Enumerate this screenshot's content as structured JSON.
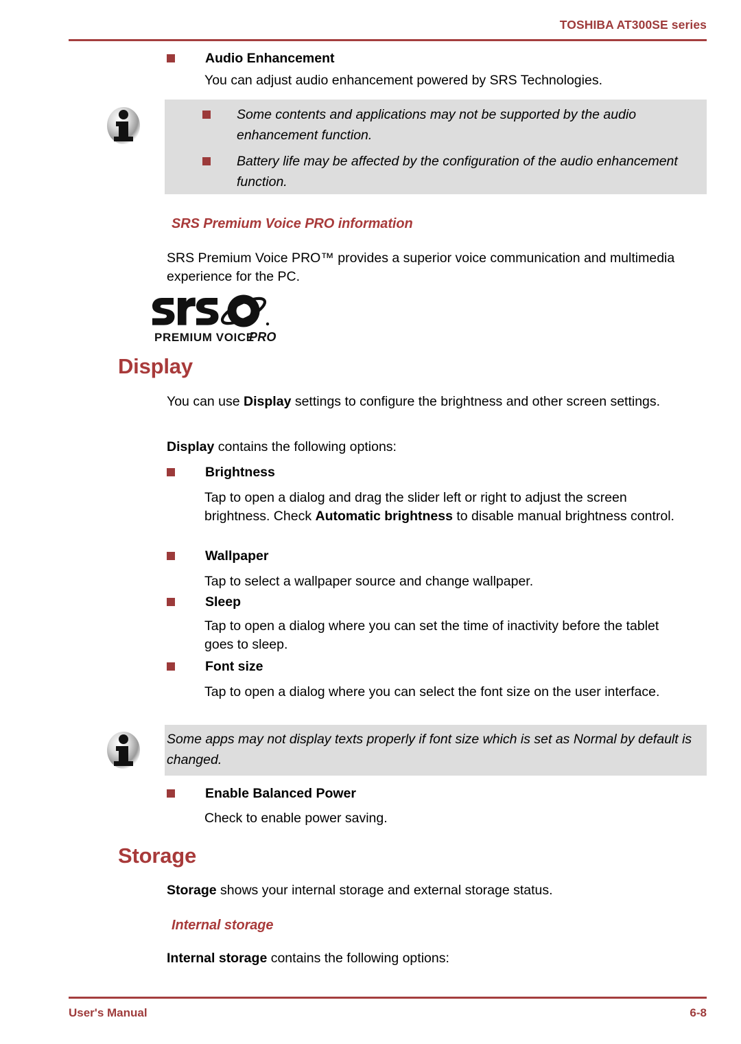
{
  "header": {
    "title": "TOSHIBA AT300SE series"
  },
  "footer": {
    "manual_label": "User's Manual",
    "page_number": "6-8"
  },
  "colors": {
    "accent_red": "#a83a3a",
    "header_red": "#9e3b3b",
    "bullet_red": "#9c3a3a",
    "note_background": "#dddddd",
    "rule_red": "#a43e3e"
  },
  "content": {
    "audio_enhancement": {
      "bullet_label": "Audio Enhancement",
      "description": "You can adjust audio enhancement powered by SRS Technologies."
    },
    "note_audio": {
      "icon": "info-icon",
      "items": [
        "Some contents and applications may not be supported by the audio enhancement function.",
        "Battery life may be affected by the configuration of the audio enhancement function."
      ]
    },
    "srs_section": {
      "heading": "SRS Premium Voice PRO information",
      "paragraph": "SRS Premium Voice PRO™ provides a superior voice communication and multimedia experience for the PC.",
      "logo": {
        "wordmark": "srs",
        "tagline": "PREMIUM VOICE PRO"
      }
    },
    "display_section": {
      "heading": "Display",
      "intro_pre": "You can use ",
      "intro_bold": "Display",
      "intro_post": " settings to configure the brightness and other screen settings.",
      "contains_bold": "Display",
      "contains_post": " contains the following options:",
      "options": [
        {
          "label": "Brightness",
          "desc_pre": "Tap to open a dialog and drag the slider left or right to adjust the screen brightness. Check ",
          "desc_bold": "Automatic brightness",
          "desc_post": " to disable manual brightness control."
        },
        {
          "label": "Wallpaper",
          "desc_pre": "Tap to select a wallpaper source and change wallpaper.",
          "desc_bold": "",
          "desc_post": ""
        },
        {
          "label": "Sleep",
          "desc_pre": "Tap to open a dialog where you can set the time of inactivity before the tablet goes to sleep.",
          "desc_bold": "",
          "desc_post": ""
        },
        {
          "label": "Font size",
          "desc_pre": "Tap to open a dialog where you can select the font size on the user interface.",
          "desc_bold": "",
          "desc_post": ""
        }
      ]
    },
    "note_fontsize": {
      "icon": "info-icon",
      "text": "Some apps may not display texts properly if font size which is set as Normal by default is changed."
    },
    "balanced_power": {
      "bullet_label": "Enable Balanced Power",
      "description": "Check to enable power saving."
    },
    "storage_section": {
      "heading": "Storage",
      "intro_bold": "Storage",
      "intro_post": " shows your internal storage and external storage status.",
      "sub_heading": "Internal storage",
      "contains_bold": "Internal storage",
      "contains_post": " contains the following options:"
    }
  }
}
